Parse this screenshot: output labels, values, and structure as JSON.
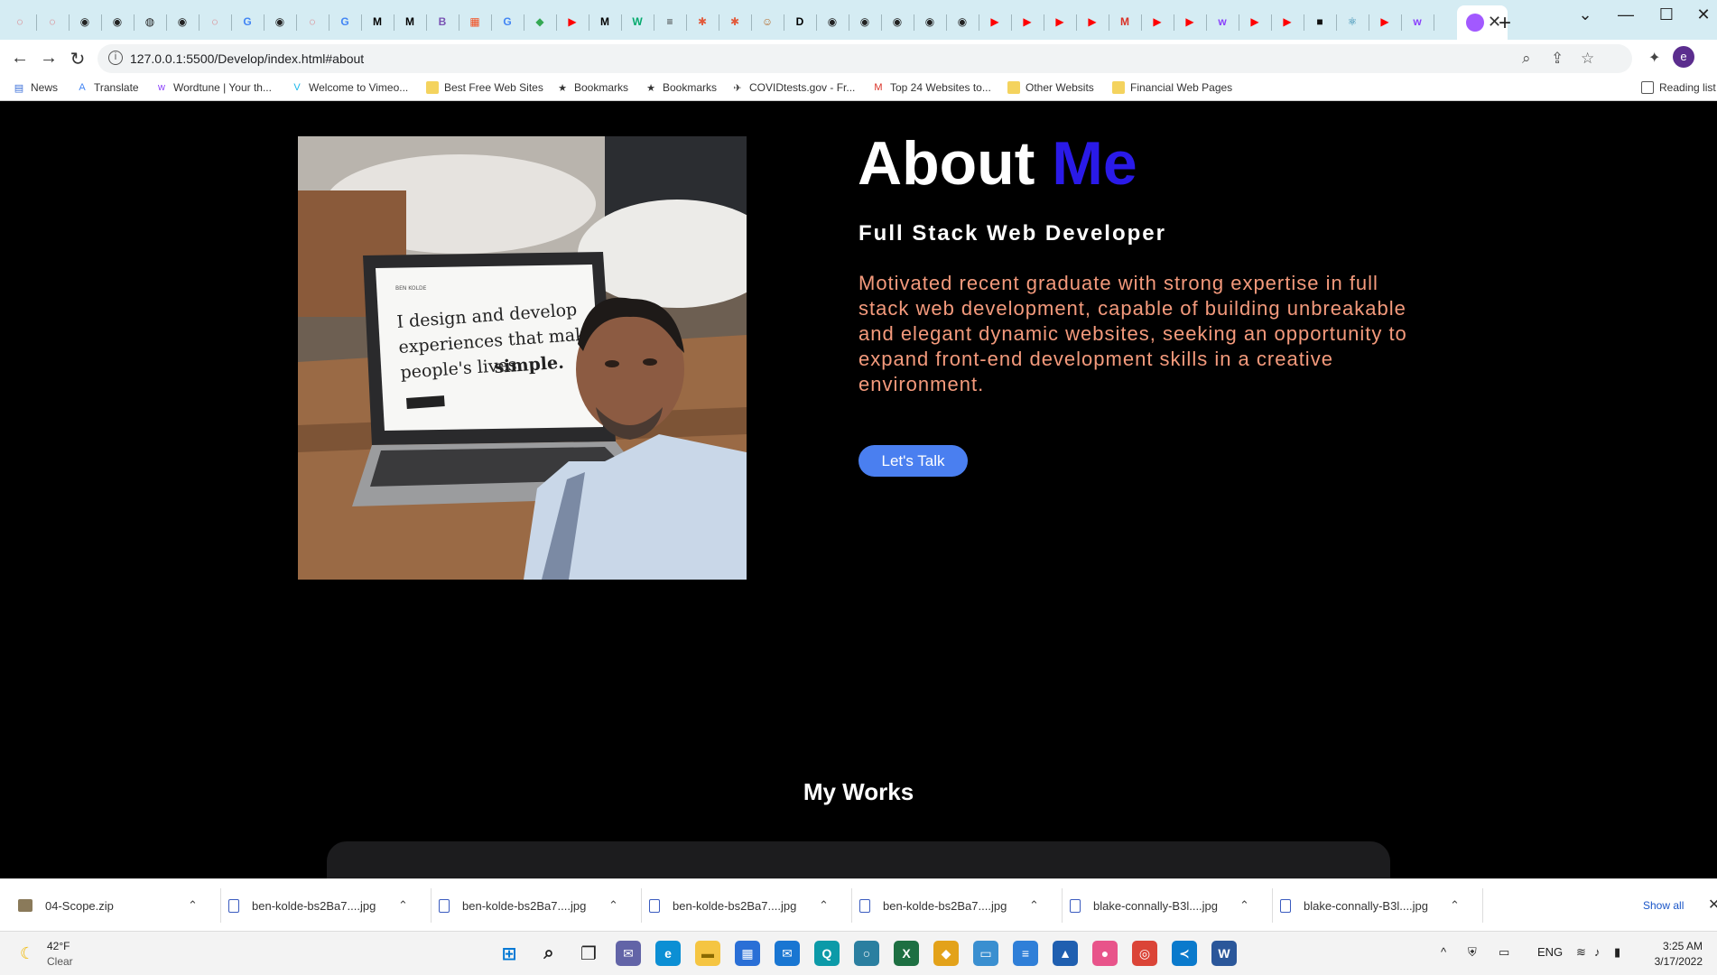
{
  "browser": {
    "url": "127.0.0.1:5500/Develop/index.html#about",
    "tab_icons": [
      "opera-icon",
      "opera-icon",
      "github-icon",
      "github-icon",
      "globe-icon",
      "github-icon",
      "opera-icon",
      "google-icon",
      "github-icon",
      "opera-icon",
      "google-icon",
      "medium-icon",
      "medium-icon",
      "bootstrap-icon",
      "microsoft-icon",
      "google-icon",
      "maps-icon",
      "youtube-icon",
      "medium-icon",
      "w3schools-icon",
      "docs-icon",
      "asterisk-icon",
      "asterisk-icon",
      "cat-icon",
      "dev-icon",
      "github-icon",
      "github-icon",
      "github-icon",
      "github-icon",
      "github-icon",
      "youtube-icon",
      "youtube-icon",
      "youtube-icon",
      "youtube-icon",
      "gmail-icon",
      "youtube-icon",
      "youtube-icon",
      "wordtune-icon",
      "youtube-icon",
      "youtube-icon",
      "square-icon",
      "react-icon",
      "youtube-icon",
      "wordtune-icon"
    ],
    "active_tab_icon": "wordtune-icon",
    "profile_initial": "e",
    "new_tab_glyph": "+",
    "close_glyph": "✕"
  },
  "bookmarks": {
    "items": [
      {
        "label": "News",
        "icon": "news-icon"
      },
      {
        "label": "Translate",
        "icon": "translate-icon"
      },
      {
        "label": "Wordtune | Your th...",
        "icon": "wordtune-icon"
      },
      {
        "label": "Welcome to Vimeo...",
        "icon": "vimeo-icon"
      },
      {
        "label": "Best Free Web Sites",
        "icon": "folder-icon"
      },
      {
        "label": "Bookmarks",
        "icon": "star-icon"
      },
      {
        "label": "Bookmarks",
        "icon": "star-icon"
      },
      {
        "label": "COVIDtests.gov - Fr...",
        "icon": "eagle-icon"
      },
      {
        "label": "Top 24 Websites to...",
        "icon": "m-icon"
      },
      {
        "label": "Other Websits",
        "icon": "folder-icon"
      },
      {
        "label": "Financial Web Pages",
        "icon": "folder-icon"
      }
    ],
    "reading_list": "Reading list"
  },
  "about": {
    "title_main": "About",
    "title_accent": "Me",
    "subtitle": "Full Stack Web Developer",
    "bio": "Motivated recent graduate with strong expertise in full stack web development, capable of building unbreakable and elegant dynamic websites, seeking an opportunity to expand front-end development skills in a creative environment.",
    "cta_label": "Let's Talk",
    "photo_screen_text_1": "I design and develop",
    "photo_screen_text_2": "experiences that make",
    "photo_screen_text_3": "people's lives",
    "photo_screen_text_4": "simple.",
    "photo_screen_brand": "BEN KOLDE"
  },
  "works": {
    "title": "My Works"
  },
  "downloads": {
    "items": [
      {
        "name": "04-Scope.zip",
        "type": "zip"
      },
      {
        "name": "ben-kolde-bs2Ba7....jpg",
        "type": "file"
      },
      {
        "name": "ben-kolde-bs2Ba7....jpg",
        "type": "file"
      },
      {
        "name": "ben-kolde-bs2Ba7....jpg",
        "type": "file"
      },
      {
        "name": "ben-kolde-bs2Ba7....jpg",
        "type": "file"
      },
      {
        "name": "blake-connally-B3l....jpg",
        "type": "file"
      },
      {
        "name": "blake-connally-B3l....jpg",
        "type": "file"
      }
    ],
    "show_all": "Show all"
  },
  "taskbar": {
    "weather_temp": "42°F",
    "weather_desc": "Clear",
    "language": "ENG",
    "time": "3:25 AM",
    "date": "3/17/2022",
    "apps": [
      "windows-start-icon",
      "search-icon",
      "task-view-icon",
      "teams-icon",
      "edge-icon",
      "file-explorer-icon",
      "store-icon",
      "mail-icon",
      "app-q-icon",
      "app-circle-icon",
      "excel-icon",
      "app-diamond-icon",
      "app-monitor-icon",
      "notepad-icon",
      "photos-icon",
      "paint-icon",
      "chrome-icon",
      "vscode-icon",
      "word-icon"
    ]
  }
}
